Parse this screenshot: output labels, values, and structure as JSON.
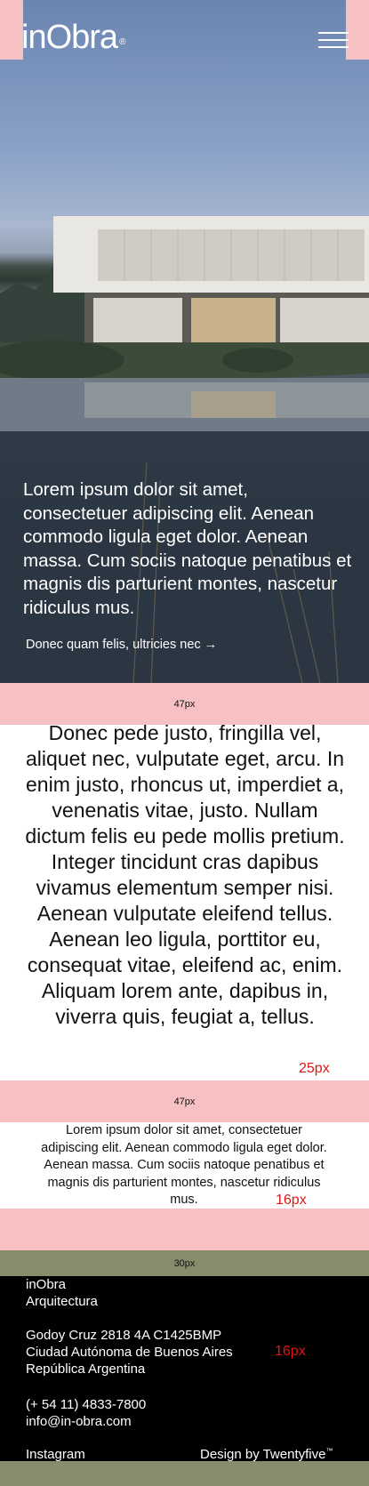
{
  "header": {
    "logo_text": "inObra",
    "logo_mark": "®",
    "menu_icon": "hamburger-menu-icon"
  },
  "hero": {
    "headline": "Lorem ipsum dolor sit amet, consectetuer adipiscing elit. Aenean commodo ligula eget dolor. Aenean massa. Cum sociis natoque penatibus et magnis dis parturient montes, nascetur ridiculus mus.",
    "link_label": "Donec quam felis, ultricies nec →"
  },
  "spacers": {
    "first": "47px",
    "second": "47px",
    "footer": "30px"
  },
  "measures": {
    "quote_margin": "25px",
    "small_margin": "16px",
    "footer_margin": "16px"
  },
  "quote": {
    "text": "Donec pede justo, fringilla vel, aliquet nec, vulputate eget, arcu. In enim justo, rhoncus ut, imperdiet a, venenatis vitae, justo. Nullam dictum felis eu pede mollis pretium. Integer tincidunt cras dapibus vivamus elementum semper nisi. Aenean vulputate eleifend tellus. Aenean leo ligula, porttitor eu, consequat vitae, eleifend ac, enim. Aliquam lorem ante, dapibus in, viverra quis, feugiat a, tellus."
  },
  "intro": {
    "text": "Lorem ipsum dolor sit amet, consectetuer adipiscing elit. Aenean commodo ligula eget dolor. Aenean massa. Cum sociis natoque penatibus et magnis dis parturient montes, nascetur ridiculus mus."
  },
  "footer": {
    "company": "inObra",
    "subtitle": "Arquitectura",
    "address_1": "Godoy Cruz 2818 4A C1425BMP",
    "address_2": "Ciudad Autónoma de Buenos Aires",
    "address_3": "República Argentina",
    "phone": "(+ 54 11) 4833-7800",
    "email": "info@in-obra.com",
    "instagram": "Instagram",
    "credit": "Design by Twentyfive",
    "credit_mark": "™"
  },
  "colors": {
    "spacer_pink": "#f7c1c3",
    "footer_olive": "#898b6d",
    "measure_red": "#e01616"
  }
}
